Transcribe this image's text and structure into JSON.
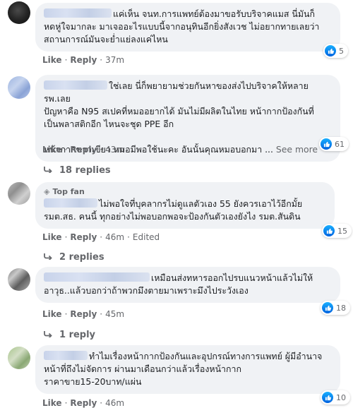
{
  "comments": [
    {
      "text": "แค่เห็น จนท.การแพทย์ต้องมาขอรับบริจาคแมส นี่มันก็หดหู่ใจมากละ มาเจออะไรแบบนี้จากอนุทินอีกยิ่งสังเวช ไม่อยากทายเลยว่าสถานการณ์มันจะย่ำแย่ลงแค่ไหน",
      "lines": [
        "แค่เห็น จนท.การแพทย์ต้องมาขอรับบริจาคแมส นี่มันก็",
        "หดหู่ใจมากละ มาเจออะไรแบบนี้จากอนุทินอีกยิ่งสังเวช ไม่อยากทายเลยว่า",
        "สถานการณ์มันจะย่ำแย่ลงแค่ไหน"
      ],
      "like": "Like",
      "reply": "Reply",
      "time": "37m",
      "reactions": "5"
    },
    {
      "lines": [
        "ใช่เลย นี่ก็พยายามช่วยกันหาของส่งไปบริจาคให้หลายรพ.เลย",
        "ปัญหาคือ N95 สเปคที่หมออยากได้ มันไม่มีผลิตในไทย หน้ากากป้องกันที่",
        "เป็นพลาสติกอีก ไหนจะชุด PPE อีก",
        "",
        "หน้ากากขาวเขียว หมอมีพอใช้นะคะ อันนั้นคุณหมอบอกมา ..."
      ],
      "see_more": "See more",
      "like": "Like",
      "reply": "Reply",
      "time": "43m",
      "reactions": "61",
      "replies_label": "18 replies"
    },
    {
      "top_fan": "Top fan",
      "lines": [
        "ไม่พอใจที่บุคลากรไม่ดูแลตัวเอง 55 ยังควรเอาไว้อีกมั้ย",
        "รมต.สธ. คนนี้ ทุกอย่างไม่พอบอกพอจะป้องกันตัวเองยังไง รมต.สันดิน"
      ],
      "like": "Like",
      "reply": "Reply",
      "time": "46m",
      "edited": "Edited",
      "reactions": "15",
      "replies_label": "2 replies"
    },
    {
      "lines": [
        "เหมือนส่งทหารออกไปรบแนวหน้าแล้วไม่ให้",
        "อาวุธ..แล้วบอกว่าถ้าพวกมึงตายมาเพราะมึงไประวังเอง"
      ],
      "like": "Like",
      "reply": "Reply",
      "time": "45m",
      "reactions": "18",
      "replies_label": "1 reply"
    },
    {
      "lines": [
        "ทำไมเรื่องหน้ากากป้องกันและอุปกรณ์ทางการแพทย์ ผู้มีอำนาจ",
        "หน้าที่ถึงไม่จัดการ ผ่านมาเดือนกว่าแล้วเรื่องหน้ากาก",
        "ราคาขาย15-20บาท/แผ่น"
      ],
      "like": "Like",
      "reply": "Reply",
      "time": "46m",
      "reactions": "10"
    }
  ],
  "colors": {
    "accent": "#1877f2",
    "bubble": "#f0f2f5",
    "meta": "#65676b"
  },
  "icons": {
    "like": "thumbs-up-icon",
    "reply_arrow": "reply-arrow-icon",
    "top_fan": "diamond-icon"
  }
}
